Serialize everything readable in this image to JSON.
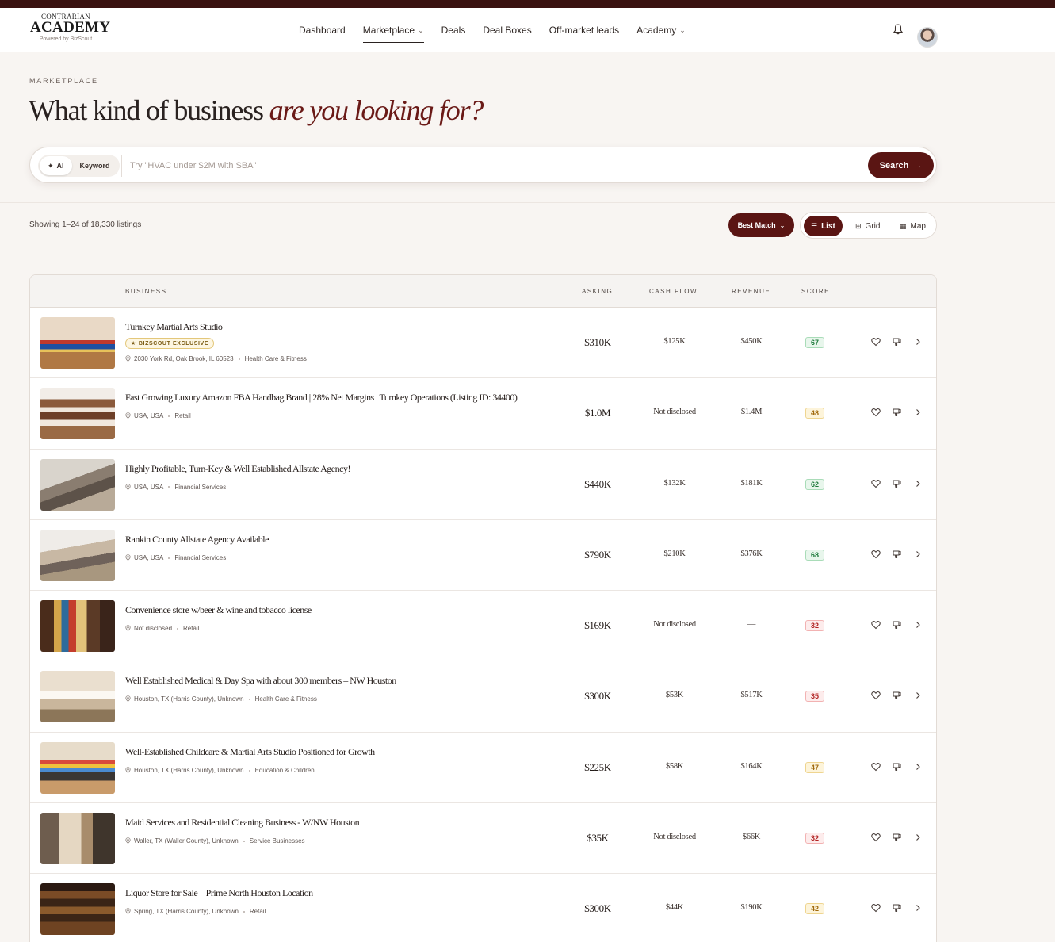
{
  "brand": {
    "line1": "CONTRARIAN",
    "line2": "ACADEMY",
    "line3": "Powered by BizScout"
  },
  "nav": {
    "items": [
      {
        "label": "Dashboard"
      },
      {
        "label": "Marketplace"
      },
      {
        "label": "Deals"
      },
      {
        "label": "Deal Boxes"
      },
      {
        "label": "Off-market leads"
      },
      {
        "label": "Academy"
      }
    ]
  },
  "hero": {
    "eyebrow": "MARKETPLACE",
    "headline_plain": "What kind of business",
    "headline_accent": "are you looking for?"
  },
  "search": {
    "mode_ai": "AI",
    "mode_keyword": "Keyword",
    "placeholder": "Try \"HVAC under $2M with SBA\"",
    "button": "Search"
  },
  "results": {
    "showing": "Showing 1–24 of 18,330 listings",
    "sort_label": "Best Match",
    "views": {
      "list": "List",
      "grid": "Grid",
      "map": "Map"
    }
  },
  "table": {
    "headers": {
      "business": "BUSINESS",
      "asking": "ASKING",
      "cash_flow": "CASH FLOW",
      "revenue": "REVENUE",
      "score": "SCORE"
    },
    "rows": [
      {
        "title": "Turnkey Martial Arts Studio",
        "badge": "BIZSCOUT EXCLUSIVE",
        "location": "2030 York Rd, Oak Brook, IL 60523",
        "category": "Health Care & Fitness",
        "asking": "$310K",
        "cash_flow": "$125K",
        "revenue": "$450K",
        "score": "67",
        "level": "high"
      },
      {
        "title": "Fast Growing Luxury Amazon FBA Handbag Brand | 28% Net Margins | Turnkey Operations (Listing ID: 34400)",
        "location": "USA, USA",
        "category": "Retail",
        "asking": "$1.0M",
        "cash_flow": "Not disclosed",
        "revenue": "$1.4M",
        "score": "48",
        "level": "mid"
      },
      {
        "title": "Highly Profitable, Turn-Key & Well Established Allstate Agency!",
        "location": "USA, USA",
        "category": "Financial Services",
        "asking": "$440K",
        "cash_flow": "$132K",
        "revenue": "$181K",
        "score": "62",
        "level": "high"
      },
      {
        "title": "Rankin County Allstate Agency Available",
        "location": "USA, USA",
        "category": "Financial Services",
        "asking": "$790K",
        "cash_flow": "$210K",
        "revenue": "$376K",
        "score": "68",
        "level": "high"
      },
      {
        "title": "Convenience store w/beer & wine and tobacco license",
        "location": "Not disclosed",
        "category": "Retail",
        "asking": "$169K",
        "cash_flow": "Not disclosed",
        "revenue": "—",
        "score": "32",
        "level": "low"
      },
      {
        "title": "Well Established Medical & Day Spa with about 300 members – NW Houston",
        "location": "Houston, TX (Harris County), Unknown",
        "category": "Health Care & Fitness",
        "asking": "$300K",
        "cash_flow": "$53K",
        "revenue": "$517K",
        "score": "35",
        "level": "low"
      },
      {
        "title": "Well-Established Childcare & Martial Arts Studio Positioned for Growth",
        "location": "Houston, TX (Harris County), Unknown",
        "category": "Education & Children",
        "asking": "$225K",
        "cash_flow": "$58K",
        "revenue": "$164K",
        "score": "47",
        "level": "mid"
      },
      {
        "title": "Maid Services and Residential Cleaning Business - W/NW Houston",
        "location": "Waller, TX (Waller County), Unknown",
        "category": "Service Businesses",
        "asking": "$35K",
        "cash_flow": "Not disclosed",
        "revenue": "$66K",
        "score": "32",
        "level": "low"
      },
      {
        "title": "Liquor Store for Sale – Prime North Houston Location",
        "location": "Spring, TX (Harris County), Unknown",
        "category": "Retail",
        "asking": "$300K",
        "cash_flow": "$44K",
        "revenue": "$190K",
        "score": "42",
        "level": "mid"
      }
    ]
  },
  "colors": {
    "brand_primary": "#5a1513",
    "topbar": "#3a1210",
    "accent_text": "#6a1a17",
    "background": "#f8f5f2"
  }
}
